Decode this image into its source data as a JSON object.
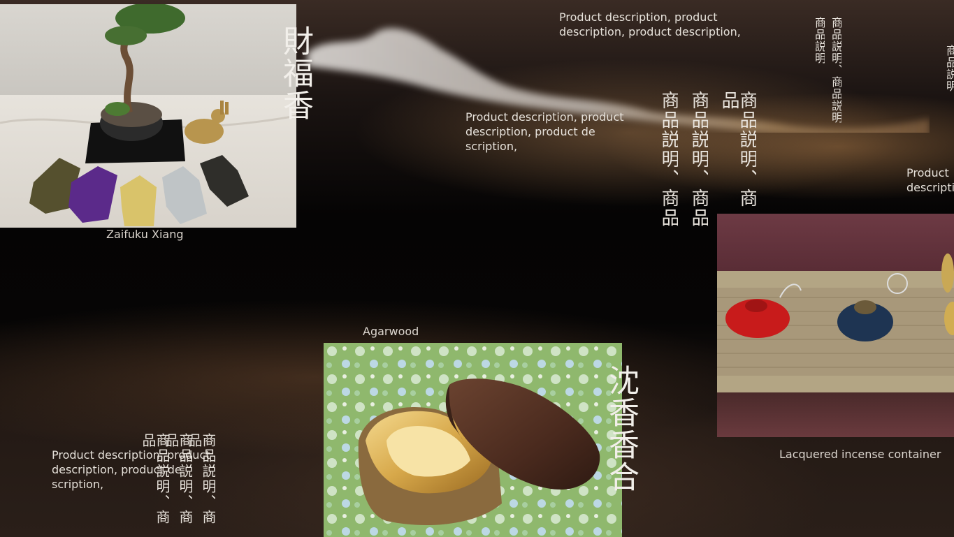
{
  "products": [
    {
      "title": "財福香",
      "caption": "Zaifuku Xiang",
      "image_icon": "bonsai-sachet-photo-icon"
    },
    {
      "title": "沈香香合",
      "caption": "Agarwood",
      "image_icon": "incense-box-photo-icon"
    },
    {
      "caption": "Lacquered incense container",
      "image_icon": "lacquer-container-photo-icon"
    }
  ],
  "descriptions": {
    "top_right": "Product description, product description, product description,",
    "middle": "Product description, product description, product de scription,",
    "right_edge": "Product description,",
    "bottom_left": "Product description, product description, product de scription,"
  },
  "vertical_text": {
    "large": "商品説明、商品",
    "small": "商品説明、商品説明",
    "edge": "商品説明"
  },
  "colors": {
    "background": "#0b0908",
    "text": "#e6e1da"
  }
}
